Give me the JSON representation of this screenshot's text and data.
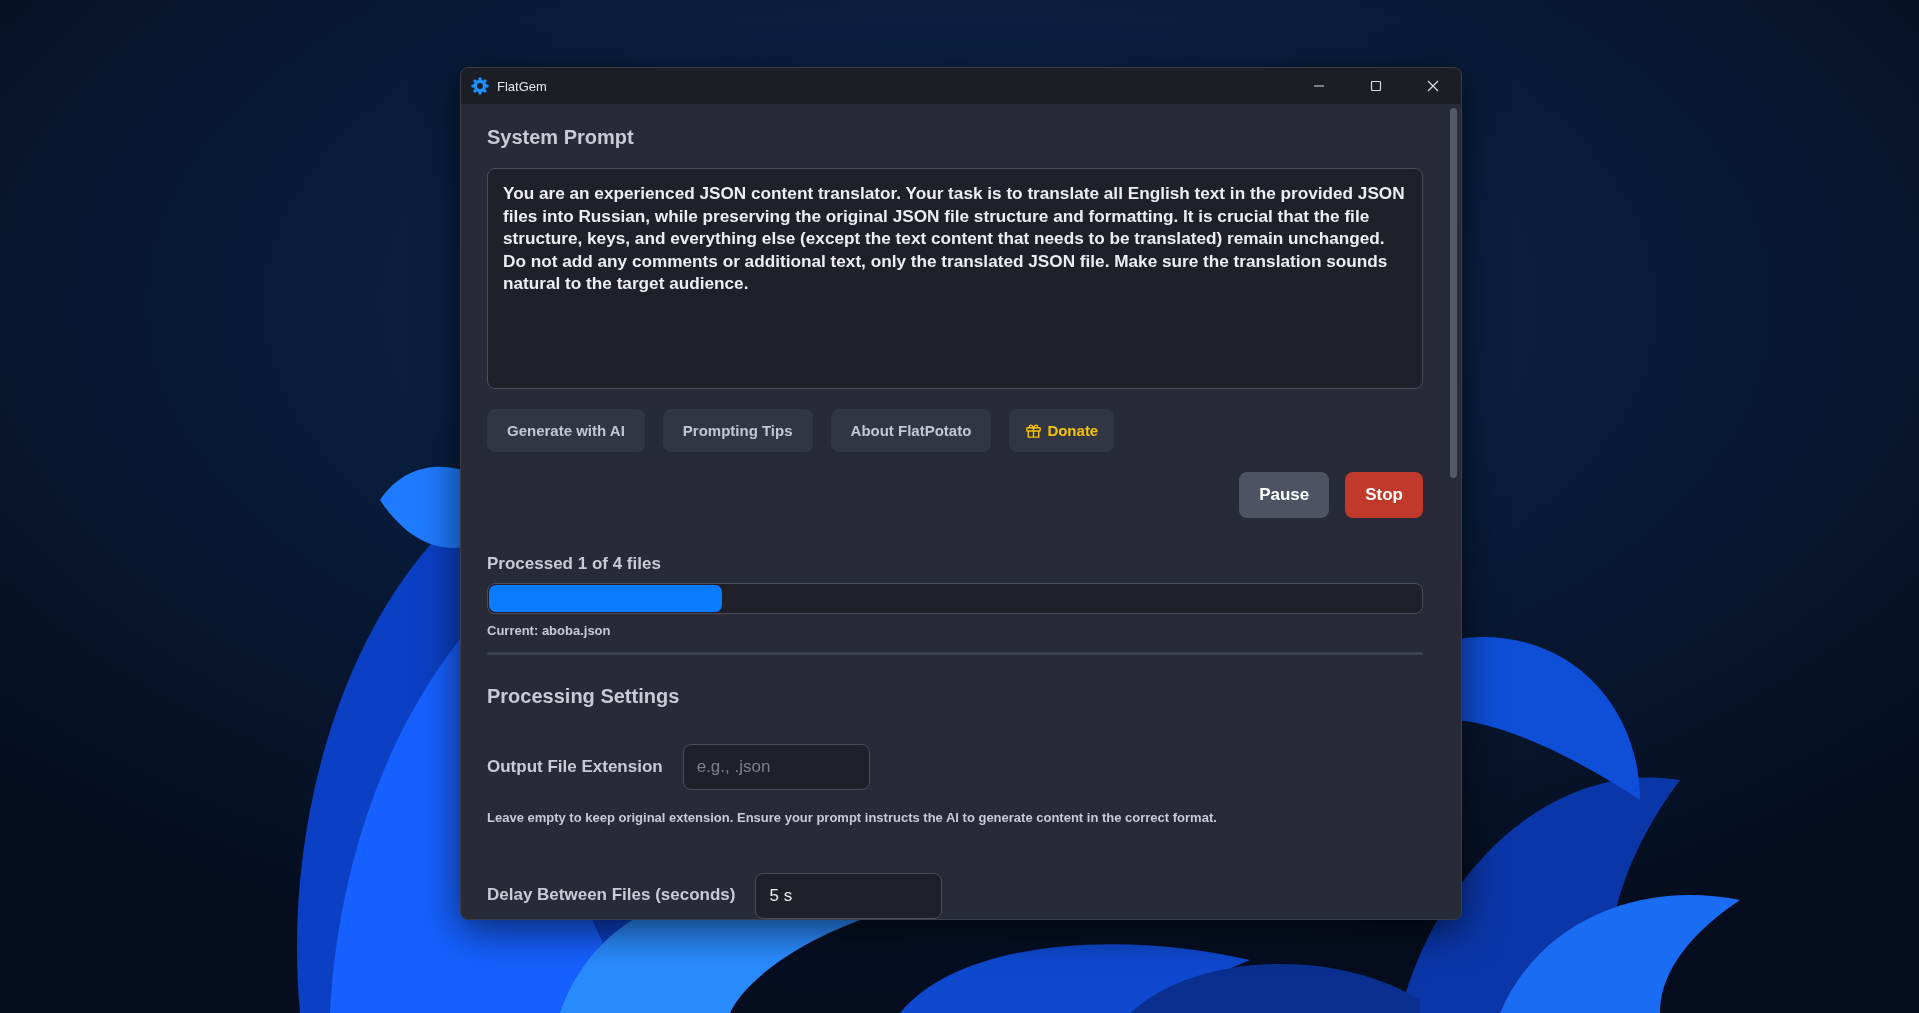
{
  "window": {
    "title": "FlatGem"
  },
  "system_prompt": {
    "heading": "System Prompt",
    "value": "You are an experienced JSON content translator. Your task is to translate all English text in the provided JSON files into Russian, while preserving the original JSON file structure and formatting. It is crucial that the file structure, keys, and everything else (except the text content that needs to be translated) remain unchanged. Do not add any comments or additional text, only the translated JSON file. Make sure the translation sounds natural to the target audience."
  },
  "action_buttons": [
    {
      "label": "Generate with AI",
      "kind": "plain"
    },
    {
      "label": "Prompting Tips",
      "kind": "plain"
    },
    {
      "label": "About FlatPotato",
      "kind": "plain"
    },
    {
      "label": "Donate",
      "kind": "donate"
    }
  ],
  "control_buttons": [
    {
      "label": "Pause",
      "kind": "neutral"
    },
    {
      "label": "Stop",
      "kind": "danger"
    }
  ],
  "progress": {
    "label": "Processed 1 of 4 files",
    "level": 0.25,
    "current": "Current: aboba.json"
  },
  "settings": {
    "heading": "Processing Settings",
    "output_extension": {
      "label": "Output File Extension",
      "placeholder": "e.g., .json",
      "hint": "Leave empty to keep original extension. Ensure your prompt instructs the AI to generate content in the correct format."
    },
    "delay": {
      "label": "Delay Between Files (seconds)",
      "value": "5 s"
    }
  }
}
